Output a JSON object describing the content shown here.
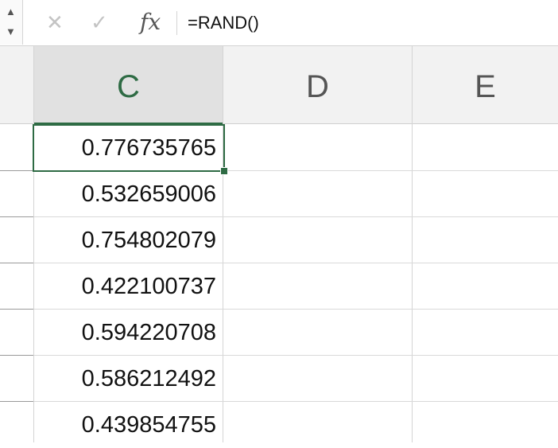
{
  "formula_bar": {
    "cancel_icon": "x-icon",
    "enter_icon": "check-icon",
    "fx_label": "fx",
    "formula": "=RAND()"
  },
  "columns": [
    {
      "label": "C",
      "selected": true
    },
    {
      "label": "D",
      "selected": false
    },
    {
      "label": "E",
      "selected": false
    }
  ],
  "cells_c": [
    "0.776735765",
    "0.532659006",
    "0.754802079",
    "0.422100737",
    "0.594220708",
    "0.586212492",
    "0.439854755"
  ],
  "colors": {
    "accent": "#2e6b44",
    "header_bg": "#f2f2f2",
    "grid": "#d9d9d9"
  }
}
